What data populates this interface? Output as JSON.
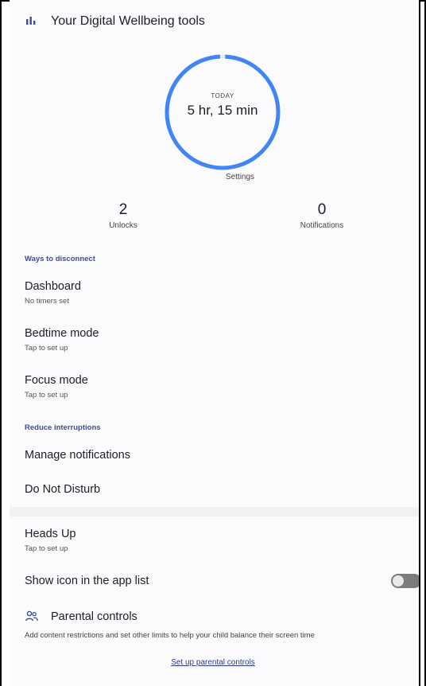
{
  "header": {
    "title": "Your Digital Wellbeing tools",
    "icon": "bar-chart-icon"
  },
  "summary": {
    "today_label": "TODAY",
    "total_time": "5 hr, 15 min",
    "settings_label": "Settings",
    "ring_color": "#4285f4",
    "ring_fill_fraction": 0.985
  },
  "stats": {
    "unlocks_value": "2",
    "unlocks_label": "Unlocks",
    "notifications_value": "0",
    "notifications_label": "Notifications"
  },
  "ways": {
    "label": "Ways to disconnect",
    "items": [
      {
        "title": "Dashboard",
        "subtitle": "No timers set"
      },
      {
        "title": "Bedtime mode",
        "subtitle": "Tap to set up"
      },
      {
        "title": "Focus mode",
        "subtitle": "Tap to set up"
      }
    ]
  },
  "interruptions": {
    "label": "Reduce interruptions",
    "items": [
      {
        "title": "Manage notifications"
      },
      {
        "title": "Do Not Disturb"
      }
    ]
  },
  "more": {
    "heads_up": {
      "title": "Heads Up",
      "subtitle": "Tap to set up"
    },
    "show_icon": {
      "title": "Show icon in the app list",
      "toggle_on": false
    }
  },
  "parental": {
    "title": "Parental controls",
    "description": "Add content restrictions and set other limits to help your child balance their screen time",
    "link": "Set up parental controls",
    "icon": "people-icon"
  },
  "colors": {
    "accent": "#3c4d9a",
    "link": "#2b3d8f",
    "ring": "#4285f4",
    "toggle_off": "#7c7c7c"
  }
}
